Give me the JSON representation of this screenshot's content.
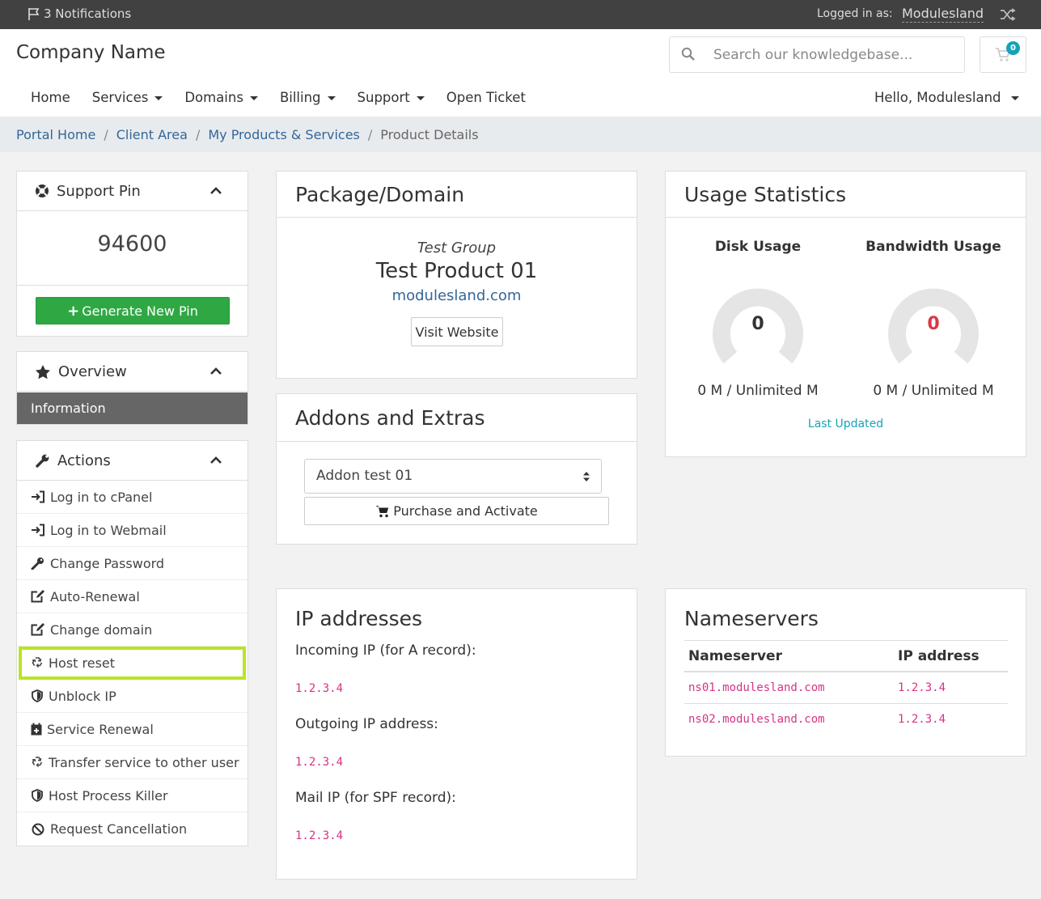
{
  "topbar": {
    "notifications": "3 Notifications",
    "logged_in_label": "Logged in as:",
    "username": "Modulesland"
  },
  "header": {
    "brand": "Company Name",
    "search_placeholder": "Search our knowledgebase...",
    "cart_count": "0",
    "nav": [
      "Home",
      "Services",
      "Domains",
      "Billing",
      "Support",
      "Open Ticket"
    ],
    "greeting": "Hello, Modulesland"
  },
  "breadcrumb": [
    "Portal Home",
    "Client Area",
    "My Products & Services",
    "Product Details"
  ],
  "support_pin": {
    "title": "Support Pin",
    "pin": "94600",
    "button": "Generate New Pin"
  },
  "overview": {
    "title": "Overview",
    "active_item": "Information"
  },
  "actions": {
    "title": "Actions",
    "items": [
      "Log in to cPanel",
      "Log in to Webmail",
      "Change Password",
      "Auto-Renewal",
      "Change domain",
      "Host reset",
      "Unblock IP",
      "Service Renewal",
      "Transfer service to other user",
      "Host Process Killer",
      "Request Cancellation"
    ]
  },
  "package": {
    "title": "Package/Domain",
    "group": "Test Group",
    "product": "Test Product 01",
    "domain": "modulesland.com",
    "visit_button": "Visit Website"
  },
  "addons": {
    "title": "Addons and Extras",
    "selected": "Addon test 01",
    "purchase_button": "Purchase and Activate"
  },
  "usage": {
    "title": "Usage Statistics",
    "disk_title": "Disk Usage",
    "disk_value": "0",
    "disk_text": "0 M / Unlimited M",
    "bw_title": "Bandwidth Usage",
    "bw_value": "0",
    "bw_text": "0 M / Unlimited M",
    "last_updated": "Last Updated",
    "disk_value_color": "#333333",
    "bw_value_color": "#dc3545"
  },
  "ip_addresses": {
    "title": "IP addresses",
    "incoming_label": "Incoming IP (for A record):",
    "incoming_ip": "1.2.3.4",
    "outgoing_label": "Outgoing IP address:",
    "outgoing_ip": "1.2.3.4",
    "mail_label": "Mail IP (for SPF record):",
    "mail_ip": "1.2.3.4"
  },
  "nameservers": {
    "title": "Nameservers",
    "col_ns": "Nameserver",
    "col_ip": "IP address",
    "rows": [
      {
        "ns": "ns01.modulesland.com",
        "ip": "1.2.3.4"
      },
      {
        "ns": "ns02.modulesland.com",
        "ip": "1.2.3.4"
      }
    ]
  },
  "colors": {
    "topbar": "#414141",
    "generate_button": "#2fa844",
    "link": "#336699",
    "highlight": "#b8e526",
    "code": "#d63384"
  }
}
